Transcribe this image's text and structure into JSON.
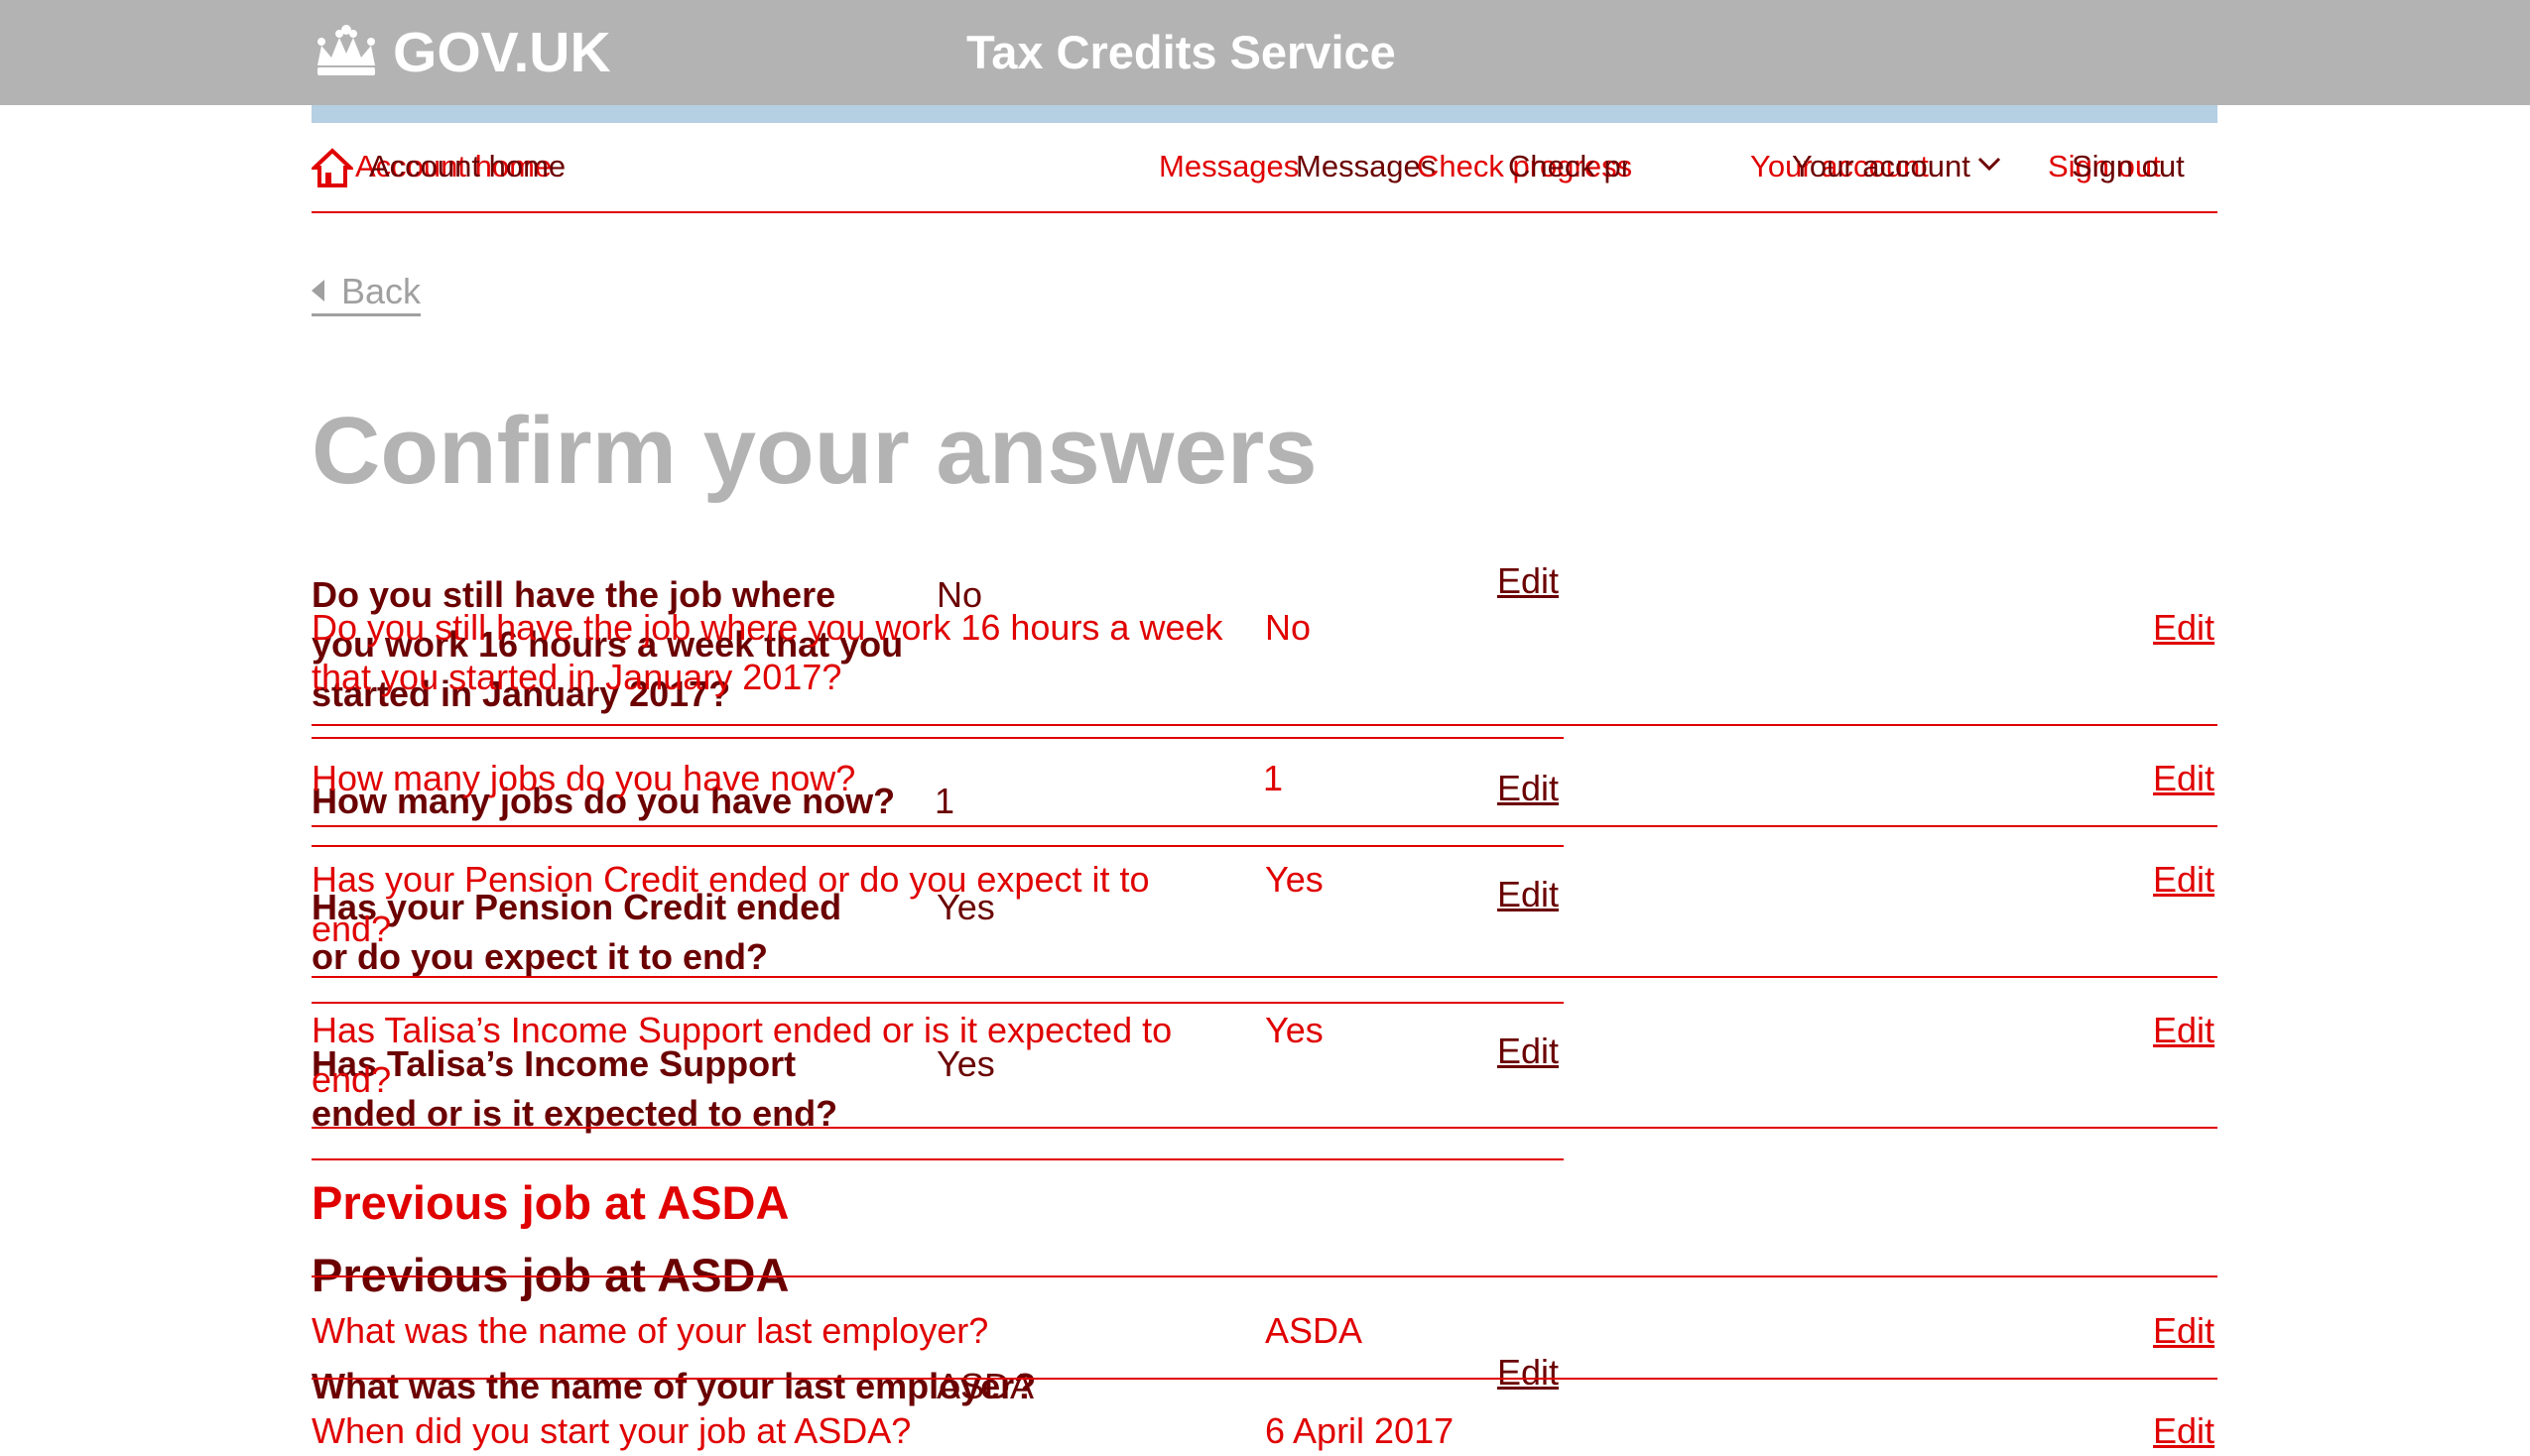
{
  "header": {
    "logo": "GOV.UK",
    "service_name": "Tax Credits Service"
  },
  "nav": {
    "account_home": "Account home",
    "messages": "Messages",
    "check_progress": "Check progress",
    "your_account": "Your account",
    "sign_out": "Sign out"
  },
  "back": "Back",
  "title": "Confirm your answers",
  "answers": [
    {
      "question": "Do you still have the job where you work 16 hours a week that you started in January 2017?",
      "answer": "No",
      "action": "Edit"
    },
    {
      "question": "How many jobs do you have now?",
      "answer": "1",
      "action": "Edit"
    },
    {
      "question": "Has your Pension Credit ended or do you expect it to end?",
      "answer": "Yes",
      "action": "Edit"
    },
    {
      "question": "Has Talisa’s Income Support ended or is it expected to end?",
      "answer": "Yes",
      "action": "Edit"
    }
  ],
  "previous_job": {
    "heading": "Previous job at ASDA",
    "rows": [
      {
        "question": "What was the name of your last employer?",
        "answer": "ASDA",
        "action": "Edit"
      },
      {
        "question": "When did you start your job at ASDA?",
        "answer": "6 April 2017",
        "action": "Edit"
      }
    ]
  }
}
